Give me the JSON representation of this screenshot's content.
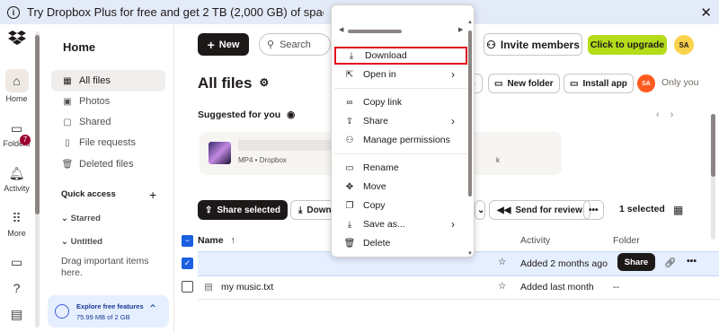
{
  "banner": {
    "text": "Try Dropbox Plus for free and get 2 TB (2,000 GB) of space and sharing feature"
  },
  "rail": {
    "home": "Home",
    "folders": "Folders",
    "activity": "Activity",
    "more": "More",
    "activity_badge": "7"
  },
  "sidebar": {
    "heading": "Home",
    "items": [
      {
        "label": "All files"
      },
      {
        "label": "Photos"
      },
      {
        "label": "Shared"
      },
      {
        "label": "File requests"
      },
      {
        "label": "Deleted files"
      }
    ],
    "quick_access": "Quick access",
    "starred": "Starred",
    "untitled": "Untitled",
    "drag_hint": "Drag important items here.",
    "promo_title": "Explore free features",
    "promo_usage": "75.99 MB of 2 GB"
  },
  "topbar": {
    "new_label": "New",
    "search_placeholder": "Search",
    "invite_label": "Invite members",
    "upgrade_label": "Click to upgrade",
    "avatar": "SA"
  },
  "page": {
    "title": "All files",
    "upload_folder_label": "New folder",
    "install_app_label": "Install app",
    "owner_avatar": "SA",
    "only_you": "Only you",
    "suggested_title": "Suggested for you"
  },
  "suggested": {
    "meta": "MP4 • Dropbox",
    "trailing": "k"
  },
  "toolbar": {
    "share_selected": "Share selected",
    "download": "Down",
    "send_review": "Send for review",
    "selected_count": "1 selected"
  },
  "table": {
    "headers": {
      "name": "Name",
      "activity": "Activity",
      "folder": "Folder"
    },
    "rows": [
      {
        "name": "",
        "activity": "Added 2 months ago",
        "folder": "",
        "share": "Share"
      },
      {
        "name": "my music.txt",
        "activity": "Added last month",
        "folder": "--"
      }
    ]
  },
  "context_menu": {
    "items": [
      {
        "label": "Download"
      },
      {
        "label": "Open in"
      },
      {
        "label": "Copy link"
      },
      {
        "label": "Share"
      },
      {
        "label": "Manage permissions"
      },
      {
        "label": "Rename"
      },
      {
        "label": "Move"
      },
      {
        "label": "Copy"
      },
      {
        "label": "Save as..."
      },
      {
        "label": "Delete"
      }
    ]
  },
  "colors": {
    "accent_blue": "#1a5fe0",
    "upgrade_green": "#b4dc19",
    "highlight_red": "#e1101c",
    "banner_bg": "#e3eaf8"
  }
}
